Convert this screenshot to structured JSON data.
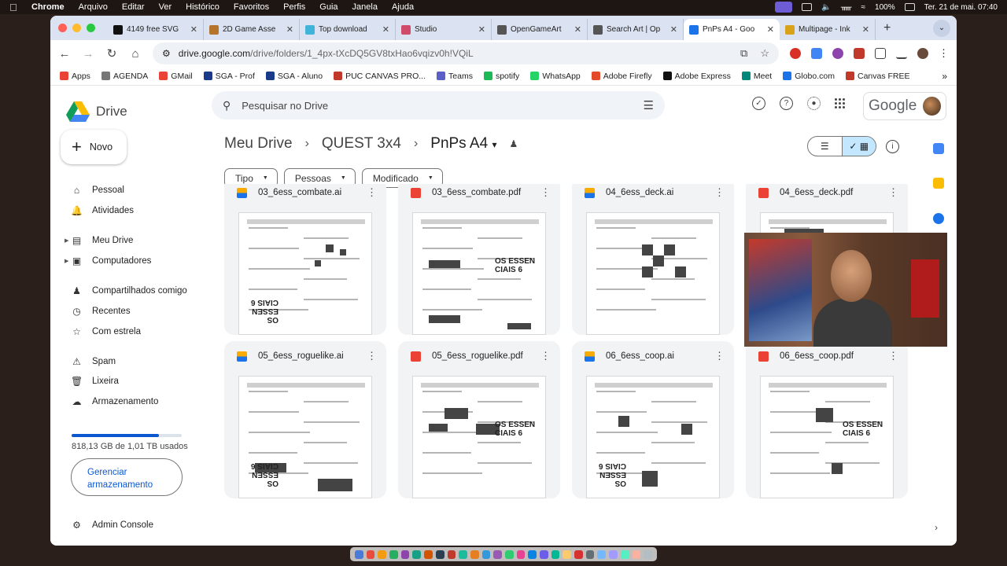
{
  "menubar": {
    "app": "Chrome",
    "menus": [
      "Arquivo",
      "Editar",
      "Ver",
      "Histórico",
      "Favoritos",
      "Perfis",
      "Guia",
      "Janela",
      "Ajuda"
    ],
    "battery": "100%",
    "clock": "Ter. 21 de mai.  07:40"
  },
  "browser": {
    "tabs": [
      {
        "title": "4149 free SVG",
        "color": "#111111"
      },
      {
        "title": "2D Game Asse",
        "color": "#b5742a"
      },
      {
        "title": "Top download",
        "color": "#3fb4d8"
      },
      {
        "title": "Studio",
        "color": "#d04a6a"
      },
      {
        "title": "OpenGameArt",
        "color": "#555555"
      },
      {
        "title": "Search Art | Op",
        "color": "#555555"
      },
      {
        "title": "PnPs A4 - Goo",
        "color": "#1a73e8",
        "active": true
      },
      {
        "title": "Multipage - Ink",
        "color": "#d9a21b"
      }
    ],
    "url_host": "drive.google.com",
    "url_path": "/drive/folders/1_4px-tXcDQ5GV8txHao6vqizv0h!VQiL",
    "bookmarks": [
      {
        "label": "Apps",
        "color": "#ea4335"
      },
      {
        "label": "AGENDA",
        "color": "#777777"
      },
      {
        "label": "GMail",
        "color": "#ea4335"
      },
      {
        "label": "SGA - Prof",
        "color": "#1a3a8a"
      },
      {
        "label": "SGA - Aluno",
        "color": "#1a3a8a"
      },
      {
        "label": "PUC CANVAS PRO...",
        "color": "#c0392b"
      },
      {
        "label": "Teams",
        "color": "#5b5fc7"
      },
      {
        "label": "spotify",
        "color": "#1db954"
      },
      {
        "label": "WhatsApp",
        "color": "#25d366"
      },
      {
        "label": "Adobe Firefly",
        "color": "#e34b2a"
      },
      {
        "label": "Adobe Express",
        "color": "#111111"
      },
      {
        "label": "Meet",
        "color": "#00897b"
      },
      {
        "label": "Globo.com",
        "color": "#1a73e8"
      },
      {
        "label": "Canvas FREE",
        "color": "#c0392b"
      }
    ]
  },
  "drive": {
    "app_name": "Drive",
    "search_placeholder": "Pesquisar no Drive",
    "account_label": "Google",
    "new_button": "Novo",
    "sidebar": {
      "items": [
        {
          "label": "Pessoal",
          "icon": "home-icon"
        },
        {
          "label": "Atividades",
          "icon": "bell-icon"
        },
        {
          "label": "Meu Drive",
          "icon": "my-drive-icon"
        },
        {
          "label": "Computadores",
          "icon": "computer-icon"
        },
        {
          "label": "Compartilhados comigo",
          "icon": "shared-icon"
        },
        {
          "label": "Recentes",
          "icon": "clock-icon"
        },
        {
          "label": "Com estrela",
          "icon": "star-icon"
        },
        {
          "label": "Spam",
          "icon": "spam-icon"
        },
        {
          "label": "Lixeira",
          "icon": "trash-icon"
        },
        {
          "label": "Armazenamento",
          "icon": "cloud-icon"
        }
      ],
      "storage_text": "818,13 GB de 1,01 TB usados",
      "storage_used_fraction": 0.79,
      "manage_button": "Gerenciar armazenamento",
      "admin": "Admin Console"
    },
    "breadcrumb": [
      "Meu Drive",
      "QUEST 3x4",
      "PnPs A4"
    ],
    "filters": [
      "Tipo",
      "Pessoas",
      "Modificado"
    ],
    "files": [
      {
        "name": "03_6ess_combate.ai",
        "type": "ai"
      },
      {
        "name": "03_6ess_combate.pdf",
        "type": "pdf"
      },
      {
        "name": "04_6ess_deck.ai",
        "type": "ai"
      },
      {
        "name": "04_6ess_deck.pdf",
        "type": "pdf"
      },
      {
        "name": "05_6ess_roguelike.ai",
        "type": "ai"
      },
      {
        "name": "05_6ess_roguelike.pdf",
        "type": "pdf"
      },
      {
        "name": "06_6ess_coop.ai",
        "type": "ai"
      },
      {
        "name": "06_6ess_coop.pdf",
        "type": "pdf"
      }
    ],
    "thumb_text": "OS ESSEN CIAIS 6"
  }
}
